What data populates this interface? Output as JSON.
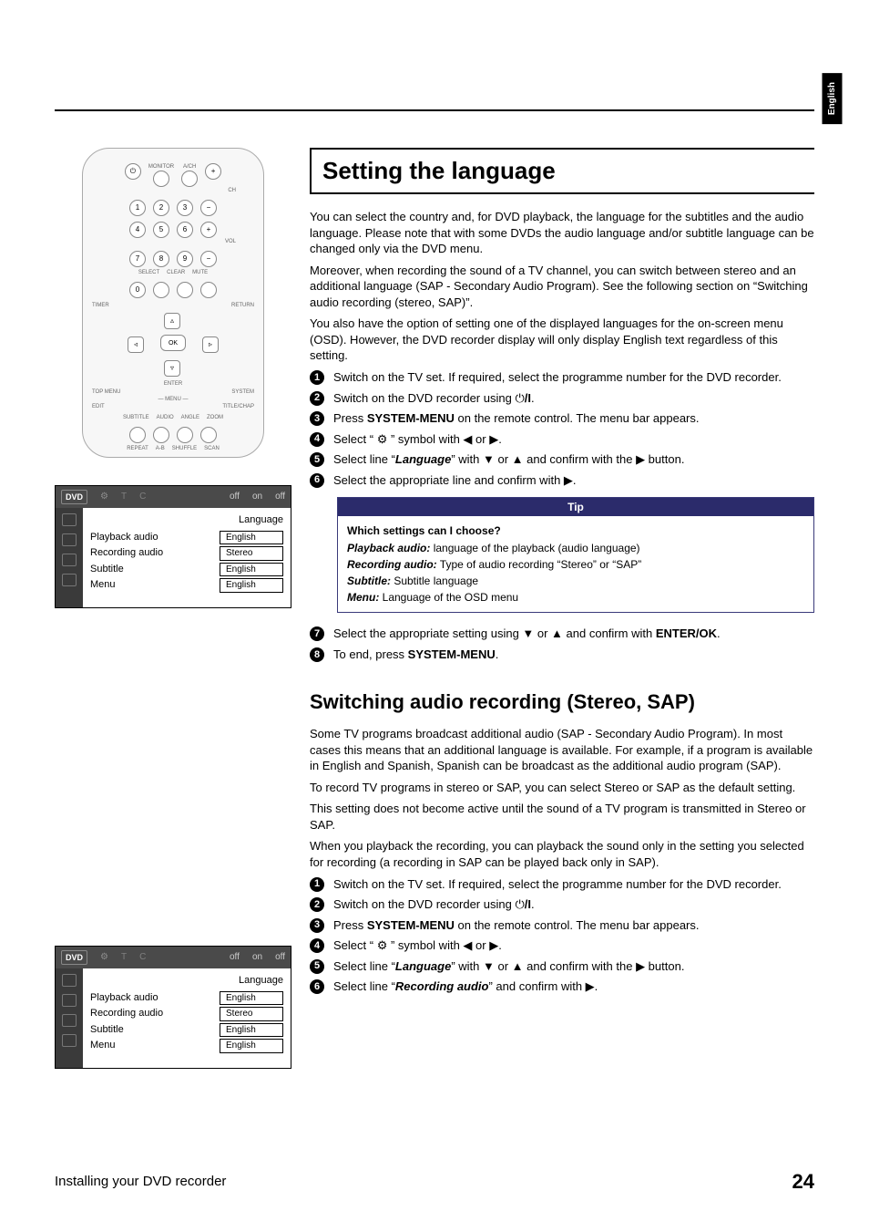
{
  "lang_tab": "English",
  "footer": {
    "left": "Installing your DVD recorder",
    "page": "24"
  },
  "screen1": {
    "header_labels": [
      "off",
      "on",
      "off"
    ],
    "title": "Language",
    "rows": [
      {
        "label": "Playback audio",
        "value": "English",
        "hl": true
      },
      {
        "label": "Recording audio",
        "value": "Stereo",
        "hl": false
      },
      {
        "label": "Subtitle",
        "value": "English",
        "hl": false
      },
      {
        "label": "Menu",
        "value": "English",
        "hl": false
      }
    ]
  },
  "screen2": {
    "header_labels": [
      "off",
      "on",
      "off"
    ],
    "title": "Language",
    "rows": [
      {
        "label": "Playback audio",
        "value": "English",
        "hl": true
      },
      {
        "label": "Recording audio",
        "value": "Stereo",
        "hl": false
      },
      {
        "label": "Subtitle",
        "value": "English",
        "hl": false
      },
      {
        "label": "Menu",
        "value": "English",
        "hl": false
      }
    ]
  },
  "remote_labels": {
    "row1": [
      "MONITOR",
      "A/CH"
    ],
    "row_ch": "CH",
    "row_vol": "VOL",
    "row4_sub": [
      "SELECT",
      "CLEAR",
      "MUTE"
    ],
    "timer": "TIMER",
    "return": "RETURN",
    "ok": "OK",
    "enter": "ENTER",
    "topmenu": "TOP MENU",
    "system": "SYSTEM",
    "menu": "MENU",
    "edit": "EDIT",
    "titlechap": "TITLE/CHAP",
    "bottom": [
      "SUBTITLE",
      "AUDIO",
      "ANGLE",
      "ZOOM"
    ],
    "last": [
      "REPEAT",
      "A-B",
      "SHUFFLE",
      "SCAN"
    ]
  },
  "s1": {
    "title": "Setting the language",
    "intro": [
      "You can select the country and, for DVD playback, the language for the subtitles and the audio language. Please note that with some DVDs the audio language and/or subtitle language can be changed only via the DVD menu.",
      "Moreover, when recording the sound of a TV channel, you can switch between stereo and an additional language (SAP - Secondary Audio Program). See the following section on “Switching audio recording (stereo, SAP)”.",
      "You also have the option of setting one of the displayed languages for the on-screen menu (OSD). However, the DVD recorder display will only display English text regardless of this setting."
    ],
    "steps": [
      "Switch on the TV set. If required, select the programme number for the DVD recorder.",
      "Switch on the DVD recorder using ⏻/I.",
      "Press SYSTEM-MENU on the remote control. The menu bar appears.",
      "Select “ ⚙ ” symbol with ◀ or ▶.",
      "Select line “Language” with ▼ or ▲ and confirm with the ▶ button.",
      "Select the appropriate line and confirm with ▶."
    ],
    "tip": {
      "head": "Tip",
      "q": "Which settings can I choose?",
      "rows": [
        {
          "b": "Playback audio:",
          "t": " language of the playback (audio language)"
        },
        {
          "b": "Recording audio:",
          "t": " Type of audio recording “Stereo” or “SAP”"
        },
        {
          "b": "Subtitle:",
          "t": " Subtitle language"
        },
        {
          "b": "Menu:",
          "t": " Language of the OSD menu"
        }
      ]
    },
    "steps_after": [
      "Select the appropriate setting using ▼ or ▲ and confirm with ENTER/OK.",
      "To end, press SYSTEM-MENU."
    ]
  },
  "s2": {
    "title": "Switching audio recording (Stereo, SAP)",
    "intro": [
      "Some TV programs broadcast additional audio (SAP - Secondary Audio Program). In most cases this means that an additional language is available. For example, if a program is available in English and Spanish, Spanish can be broadcast as the additional audio program (SAP).",
      "To record TV programs in stereo or SAP, you can select Stereo or SAP as the default setting.",
      "This setting does not become active until the sound of a TV program is transmitted in Stereo or SAP.",
      "When you playback the recording, you can playback the sound only in the setting you selected for recording (a recording in SAP can be played back only in SAP)."
    ],
    "steps": [
      "Switch on the TV set. If required, select the programme number for the DVD recorder.",
      "Switch on the DVD recorder using ⏻/I.",
      "Press SYSTEM-MENU on the remote control. The menu bar appears.",
      "Select “ ⚙ ” symbol with ◀ or ▶.",
      "Select line “Language” with ▼ or ▲ and confirm with the ▶ button.",
      "Select line “Recording audio” and confirm with ▶."
    ]
  }
}
